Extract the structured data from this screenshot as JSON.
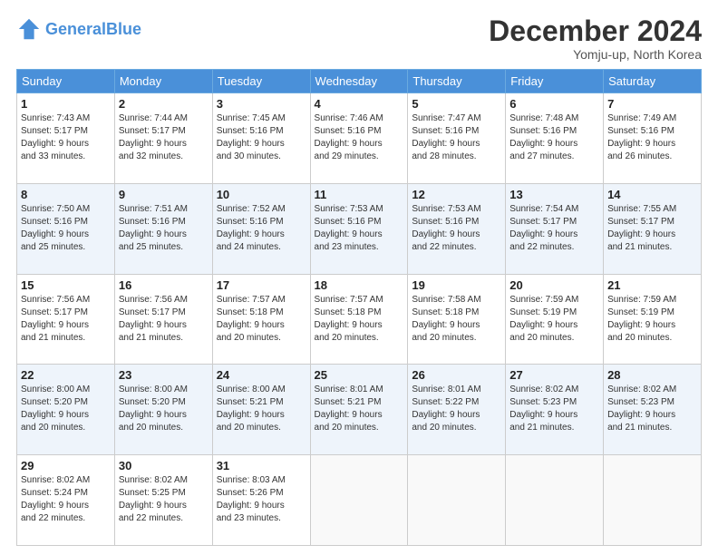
{
  "header": {
    "logo_general": "General",
    "logo_blue": "Blue",
    "month": "December 2024",
    "location": "Yomju-up, North Korea"
  },
  "weekdays": [
    "Sunday",
    "Monday",
    "Tuesday",
    "Wednesday",
    "Thursday",
    "Friday",
    "Saturday"
  ],
  "weeks": [
    [
      {
        "day": "1",
        "info": "Sunrise: 7:43 AM\nSunset: 5:17 PM\nDaylight: 9 hours\nand 33 minutes."
      },
      {
        "day": "2",
        "info": "Sunrise: 7:44 AM\nSunset: 5:17 PM\nDaylight: 9 hours\nand 32 minutes."
      },
      {
        "day": "3",
        "info": "Sunrise: 7:45 AM\nSunset: 5:16 PM\nDaylight: 9 hours\nand 30 minutes."
      },
      {
        "day": "4",
        "info": "Sunrise: 7:46 AM\nSunset: 5:16 PM\nDaylight: 9 hours\nand 29 minutes."
      },
      {
        "day": "5",
        "info": "Sunrise: 7:47 AM\nSunset: 5:16 PM\nDaylight: 9 hours\nand 28 minutes."
      },
      {
        "day": "6",
        "info": "Sunrise: 7:48 AM\nSunset: 5:16 PM\nDaylight: 9 hours\nand 27 minutes."
      },
      {
        "day": "7",
        "info": "Sunrise: 7:49 AM\nSunset: 5:16 PM\nDaylight: 9 hours\nand 26 minutes."
      }
    ],
    [
      {
        "day": "8",
        "info": "Sunrise: 7:50 AM\nSunset: 5:16 PM\nDaylight: 9 hours\nand 25 minutes."
      },
      {
        "day": "9",
        "info": "Sunrise: 7:51 AM\nSunset: 5:16 PM\nDaylight: 9 hours\nand 25 minutes."
      },
      {
        "day": "10",
        "info": "Sunrise: 7:52 AM\nSunset: 5:16 PM\nDaylight: 9 hours\nand 24 minutes."
      },
      {
        "day": "11",
        "info": "Sunrise: 7:53 AM\nSunset: 5:16 PM\nDaylight: 9 hours\nand 23 minutes."
      },
      {
        "day": "12",
        "info": "Sunrise: 7:53 AM\nSunset: 5:16 PM\nDaylight: 9 hours\nand 22 minutes."
      },
      {
        "day": "13",
        "info": "Sunrise: 7:54 AM\nSunset: 5:17 PM\nDaylight: 9 hours\nand 22 minutes."
      },
      {
        "day": "14",
        "info": "Sunrise: 7:55 AM\nSunset: 5:17 PM\nDaylight: 9 hours\nand 21 minutes."
      }
    ],
    [
      {
        "day": "15",
        "info": "Sunrise: 7:56 AM\nSunset: 5:17 PM\nDaylight: 9 hours\nand 21 minutes."
      },
      {
        "day": "16",
        "info": "Sunrise: 7:56 AM\nSunset: 5:17 PM\nDaylight: 9 hours\nand 21 minutes."
      },
      {
        "day": "17",
        "info": "Sunrise: 7:57 AM\nSunset: 5:18 PM\nDaylight: 9 hours\nand 20 minutes."
      },
      {
        "day": "18",
        "info": "Sunrise: 7:57 AM\nSunset: 5:18 PM\nDaylight: 9 hours\nand 20 minutes."
      },
      {
        "day": "19",
        "info": "Sunrise: 7:58 AM\nSunset: 5:18 PM\nDaylight: 9 hours\nand 20 minutes."
      },
      {
        "day": "20",
        "info": "Sunrise: 7:59 AM\nSunset: 5:19 PM\nDaylight: 9 hours\nand 20 minutes."
      },
      {
        "day": "21",
        "info": "Sunrise: 7:59 AM\nSunset: 5:19 PM\nDaylight: 9 hours\nand 20 minutes."
      }
    ],
    [
      {
        "day": "22",
        "info": "Sunrise: 8:00 AM\nSunset: 5:20 PM\nDaylight: 9 hours\nand 20 minutes."
      },
      {
        "day": "23",
        "info": "Sunrise: 8:00 AM\nSunset: 5:20 PM\nDaylight: 9 hours\nand 20 minutes."
      },
      {
        "day": "24",
        "info": "Sunrise: 8:00 AM\nSunset: 5:21 PM\nDaylight: 9 hours\nand 20 minutes."
      },
      {
        "day": "25",
        "info": "Sunrise: 8:01 AM\nSunset: 5:21 PM\nDaylight: 9 hours\nand 20 minutes."
      },
      {
        "day": "26",
        "info": "Sunrise: 8:01 AM\nSunset: 5:22 PM\nDaylight: 9 hours\nand 20 minutes."
      },
      {
        "day": "27",
        "info": "Sunrise: 8:02 AM\nSunset: 5:23 PM\nDaylight: 9 hours\nand 21 minutes."
      },
      {
        "day": "28",
        "info": "Sunrise: 8:02 AM\nSunset: 5:23 PM\nDaylight: 9 hours\nand 21 minutes."
      }
    ],
    [
      {
        "day": "29",
        "info": "Sunrise: 8:02 AM\nSunset: 5:24 PM\nDaylight: 9 hours\nand 22 minutes."
      },
      {
        "day": "30",
        "info": "Sunrise: 8:02 AM\nSunset: 5:25 PM\nDaylight: 9 hours\nand 22 minutes."
      },
      {
        "day": "31",
        "info": "Sunrise: 8:03 AM\nSunset: 5:26 PM\nDaylight: 9 hours\nand 23 minutes."
      },
      null,
      null,
      null,
      null
    ]
  ]
}
